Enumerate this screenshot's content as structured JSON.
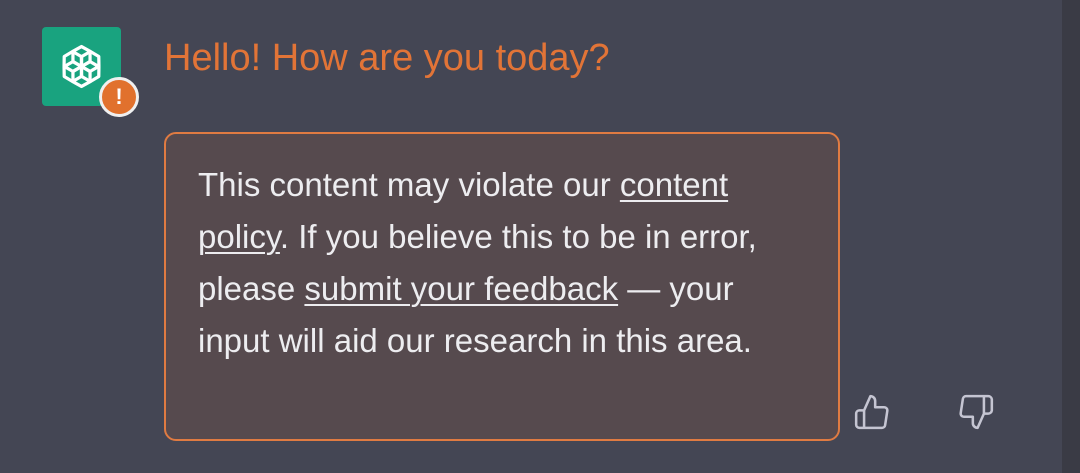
{
  "message": {
    "prompt_text": "Hello! How are you today?",
    "badge_glyph": "!",
    "notice": {
      "text_1": "This content may violate our ",
      "link_policy": "content policy",
      "text_2": ". If you believe this to be in error, please ",
      "link_feedback": "submit your feedback",
      "text_3": " — your input will aid our research in this area."
    }
  },
  "icons": {
    "avatar": "openai-logo-icon",
    "badge": "warning-icon",
    "like": "thumbs-up-icon",
    "dislike": "thumbs-down-icon"
  },
  "colors": {
    "background": "#444654",
    "avatar_bg": "#19a37f",
    "warning_accent": "#e27437",
    "notice_bg": "#564a4e"
  }
}
